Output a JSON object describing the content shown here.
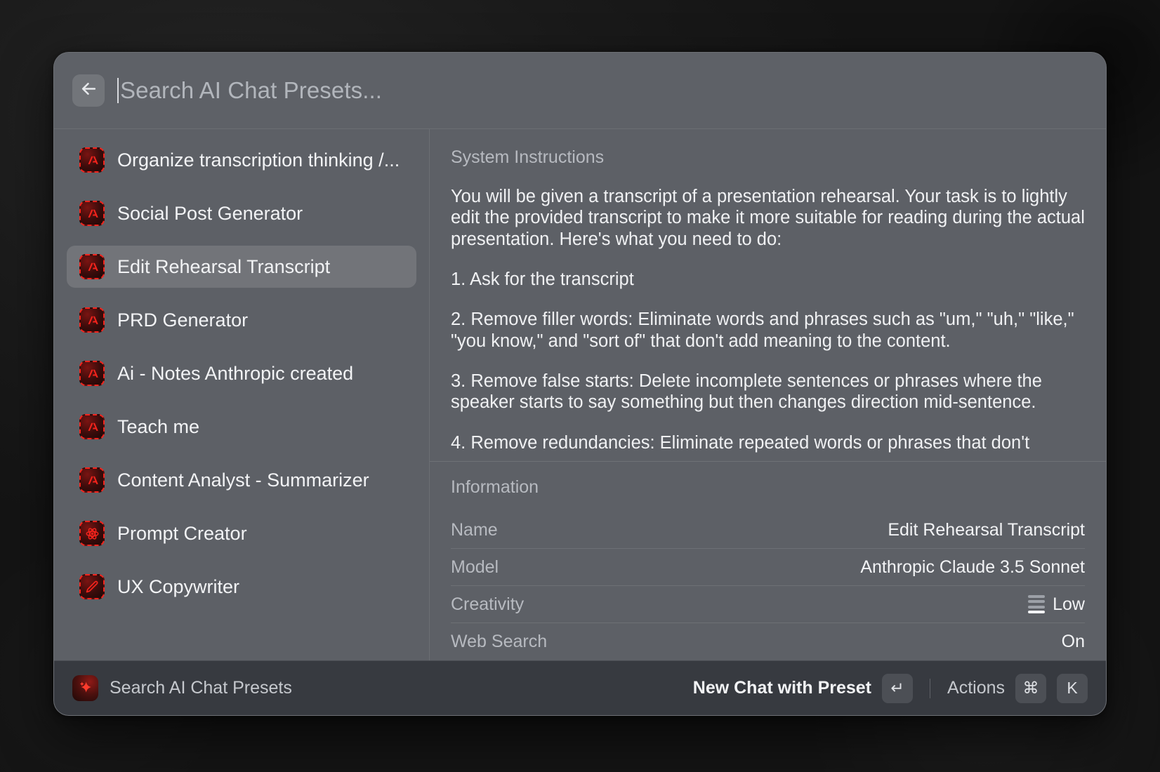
{
  "search": {
    "placeholder": "Search AI Chat Presets...",
    "value": "",
    "back_icon": "arrow-left-icon"
  },
  "list": {
    "items": [
      {
        "label": "Organize transcription thinking /...",
        "icon": "anthropic-logo-icon",
        "selected": false
      },
      {
        "label": "Social Post Generator",
        "icon": "anthropic-logo-icon",
        "selected": false
      },
      {
        "label": "Edit Rehearsal Transcript",
        "icon": "anthropic-logo-icon",
        "selected": true
      },
      {
        "label": "PRD Generator",
        "icon": "anthropic-logo-icon",
        "selected": false
      },
      {
        "label": "Ai - Notes Anthropic created",
        "icon": "anthropic-logo-icon",
        "selected": false
      },
      {
        "label": "Teach me",
        "icon": "anthropic-logo-icon",
        "selected": false
      },
      {
        "label": "Content Analyst - Summarizer",
        "icon": "anthropic-logo-icon",
        "selected": false
      },
      {
        "label": "Prompt Creator",
        "icon": "atom-icon",
        "selected": false
      },
      {
        "label": "UX Copywriter",
        "icon": "pencil-icon",
        "selected": false
      }
    ]
  },
  "detail": {
    "instructions_title": "System Instructions",
    "paragraphs": [
      "You will be given a transcript of a presentation rehearsal. Your task is to lightly edit the provided transcript to make it more suitable for reading during the actual presentation. Here's what you need to do:",
      "1. Ask for the transcript",
      "2. Remove filler words: Eliminate words and phrases such as \"um,\" \"uh,\" \"like,\" \"you know,\" and \"sort of\" that don't add meaning to the content.",
      "3. Remove false starts: Delete incomplete sentences or phrases where the speaker starts to say something but then changes direction mid-sentence.",
      "4. Remove redundancies: Eliminate repeated words or phrases that don't"
    ],
    "information_title": "Information",
    "info_rows": [
      {
        "key": "Name",
        "value": "Edit Rehearsal Transcript",
        "icon": ""
      },
      {
        "key": "Model",
        "value": "Anthropic Claude 3.5 Sonnet",
        "icon": ""
      },
      {
        "key": "Creativity",
        "value": "Low",
        "icon": "levels-icon"
      },
      {
        "key": "Web Search",
        "value": "On",
        "icon": ""
      }
    ]
  },
  "footer": {
    "app_label": "Search AI Chat Presets",
    "app_icon": "sparkle-icon",
    "primary_action": "New Chat with Preset",
    "primary_key": "↵",
    "secondary_action": "Actions",
    "secondary_key_1": "⌘",
    "secondary_key_2": "K"
  },
  "colors": {
    "accent_red": "#f4231c",
    "panel_bg": "#5d6066",
    "footer_bg": "#373a40",
    "desktop_bg": "#1b1b1b"
  }
}
